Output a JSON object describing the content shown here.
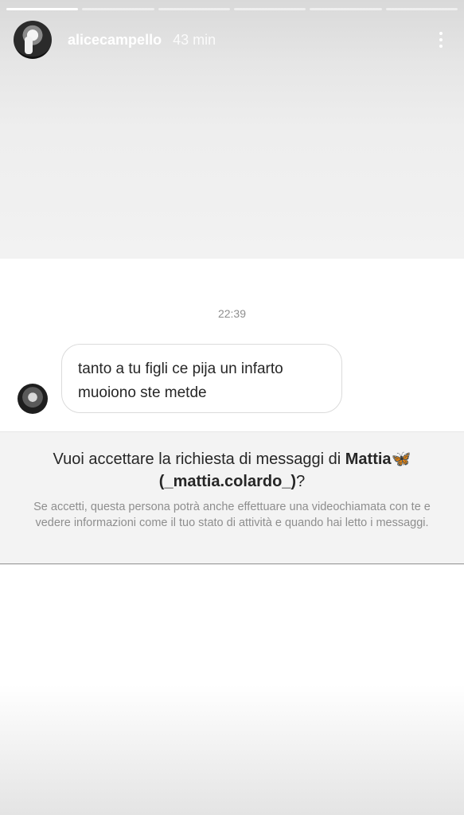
{
  "story": {
    "progress_segments": 6,
    "active_segment": 0,
    "username": "alicecampello",
    "time_ago": "43 min"
  },
  "chat": {
    "timestamp": "22:39",
    "message_line1": "tanto a tu figli ce pija un infarto",
    "message_line2": "muoiono ste metde"
  },
  "request": {
    "title_prefix": "Vuoi accettare la richiesta di messaggi di",
    "name": "Mattia",
    "emoji": "🦋",
    "handle": "(_mattia.colardo_)",
    "question_mark": "?",
    "description": "Se accetti, questa persona potrà anche effettuare una videochiamata con te e vedere informazioni come il tuo stato di attività e quando hai letto i messaggi."
  },
  "icons": {
    "more": "more-vertical-icon",
    "butterfly": "butterfly-emoji-icon"
  },
  "colors": {
    "muted_text": "#8e8e8e",
    "body_text": "#262626",
    "butterfly": "#4aa3ff"
  }
}
